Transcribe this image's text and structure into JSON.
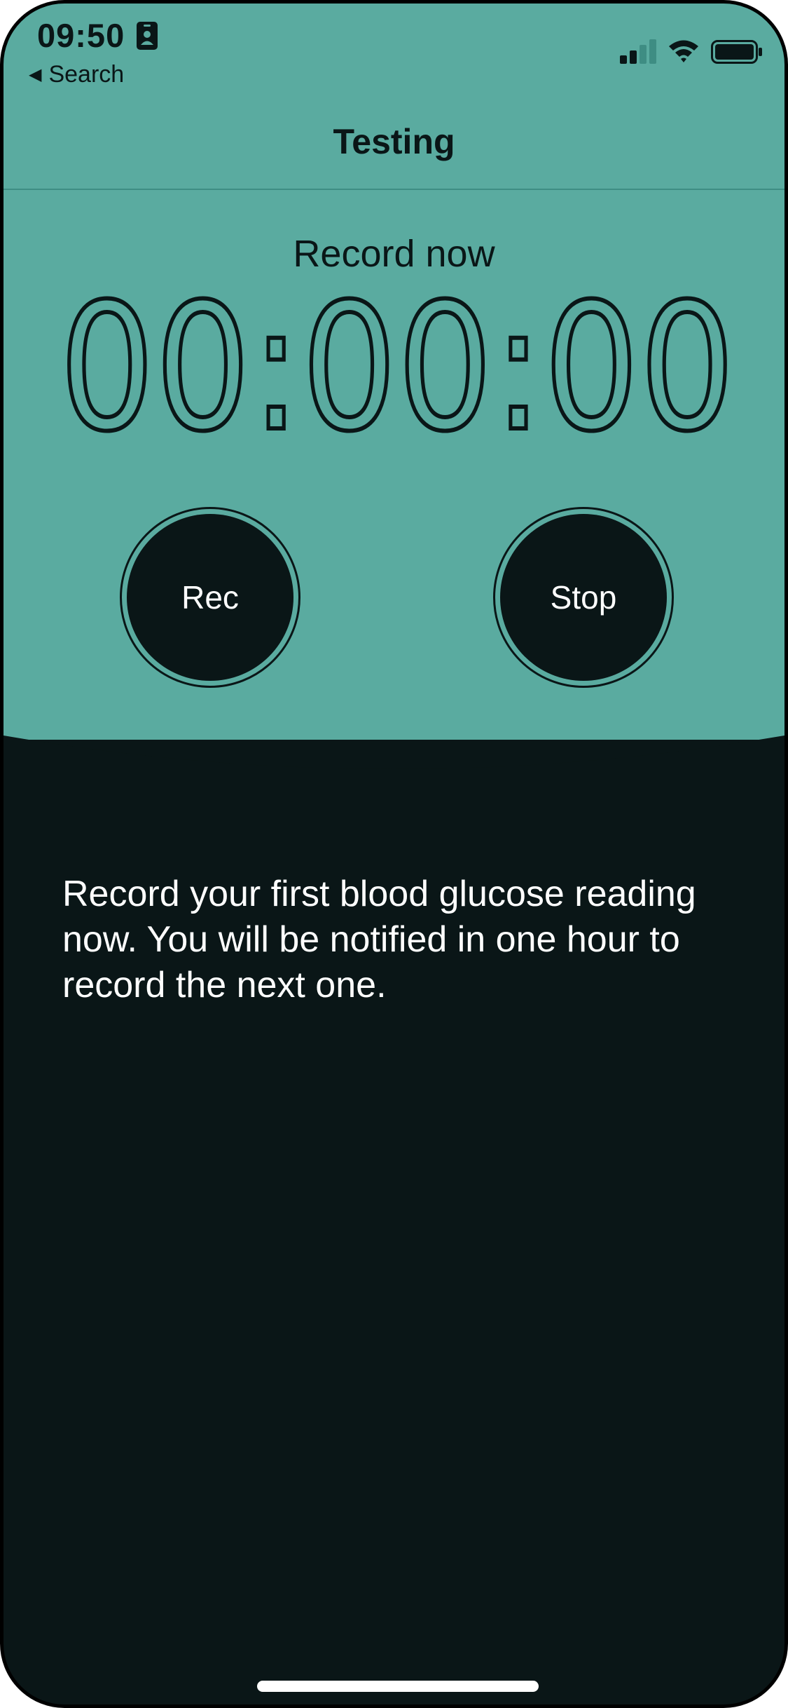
{
  "status_bar": {
    "time": "09:50",
    "icons": [
      "contact-card-icon",
      "signal-icon",
      "wifi-icon",
      "battery-icon"
    ]
  },
  "back_link": {
    "label": "Search",
    "icon": "back-triangle-icon"
  },
  "nav": {
    "title": "Testing"
  },
  "timer": {
    "label": "Record now",
    "value": "00:00:00"
  },
  "buttons": {
    "rec": "Rec",
    "stop": "Stop"
  },
  "instruction": "Record your first blood glucose reading now. You will be notified in one hour to record the next one.",
  "colors": {
    "accent": "#5aaba0",
    "dark": "#0a1617",
    "text_light": "#ffffff"
  }
}
